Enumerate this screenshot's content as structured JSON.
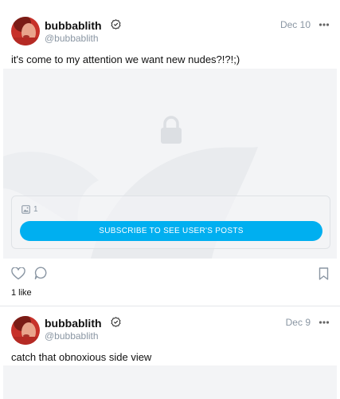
{
  "posts": [
    {
      "username": "bubbablith",
      "handle": "@bubbablith",
      "date": "Dec 10",
      "text": "it's come to my attention we want new nudes?!?!;)",
      "media_count": "1",
      "subscribe_label": "SUBSCRIBE TO SEE USER'S POSTS",
      "likes": "1 like"
    },
    {
      "username": "bubbablith",
      "handle": "@bubbablith",
      "date": "Dec 9",
      "text": "catch that obnoxious side view"
    }
  ],
  "colors": {
    "accent": "#00aff0",
    "muted": "#8a96a3",
    "locked_bg": "#f3f4f6"
  },
  "icons": [
    "verified-icon",
    "more-options-icon",
    "lock-icon",
    "image-icon",
    "like-icon",
    "comment-icon",
    "bookmark-icon"
  ]
}
